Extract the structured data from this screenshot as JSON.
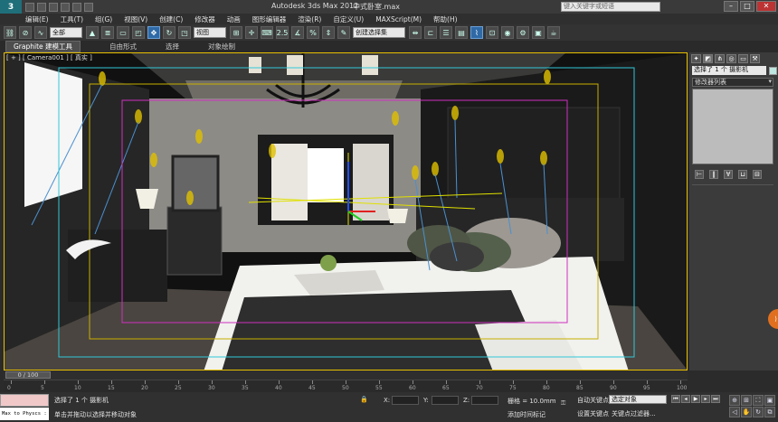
{
  "titlebar": {
    "app_title": "Autodesk 3ds Max  2012",
    "file_name": "中式卧室.max",
    "search_placeholder": "键入关键字或短语"
  },
  "menus": [
    "编辑(E)",
    "工具(T)",
    "组(G)",
    "视图(V)",
    "创建(C)",
    "修改器",
    "动画",
    "图形编辑器",
    "渲染(R)",
    "自定义(U)",
    "MAXScript(M)",
    "帮助(H)"
  ],
  "toolbar": {
    "selection_filter": "全部",
    "ref_coord": "视图",
    "named_selection": "创建选择集",
    "snap_label": "2.5",
    "percent_label": "%"
  },
  "ribbon": {
    "tabs": [
      "Graphite 建模工具",
      "自由形式",
      "选择",
      "对象绘制"
    ]
  },
  "viewport": {
    "label": "[ + ] [ Camera001 ] [ 真实 ]"
  },
  "command_panel": {
    "object_name": "选择了 1 个 摄影机",
    "modifier_list": "修改器列表"
  },
  "timeline": {
    "position": "0 / 100",
    "ticks": [
      "0",
      "5",
      "10",
      "15",
      "20",
      "25",
      "30",
      "35",
      "40",
      "45",
      "50",
      "55",
      "60",
      "65",
      "70",
      "75",
      "80",
      "85",
      "90",
      "95",
      "100"
    ]
  },
  "statusbar": {
    "maxscript_text": "Max to Physcs :",
    "selection_status": "选择了 1 个 摄影机",
    "prompt": "单击并拖动以选择并移动对象",
    "x_label": "X:",
    "y_label": "Y:",
    "z_label": "Z:",
    "grid": "栅格 = 10.0mm",
    "add_time_tag": "添加时间标记",
    "autokey": "自动关键点",
    "set_key": "设置关键点",
    "selected_object": "选定对象",
    "key_filter": "关键点过滤器..."
  },
  "colors": {
    "viewport_border": "#e8c000",
    "safe_frame_cyan": "#30c8d8",
    "safe_frame_magenta": "#d030c0",
    "autokey_red": "#b03030"
  }
}
